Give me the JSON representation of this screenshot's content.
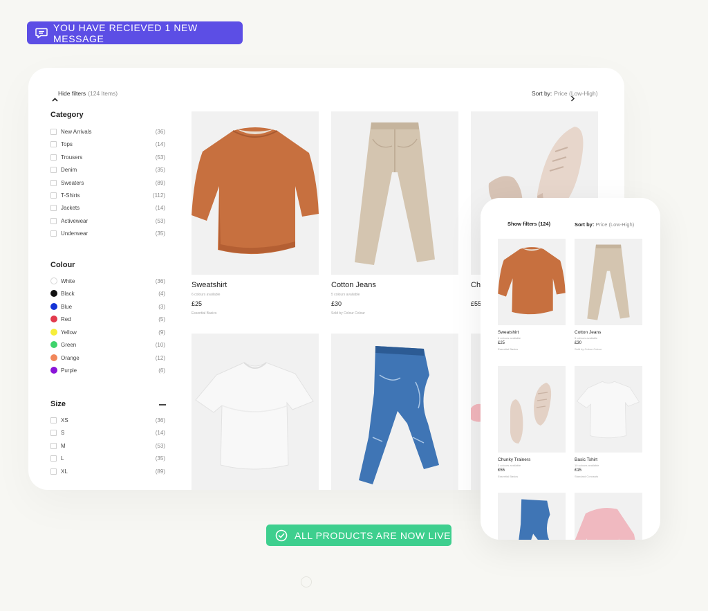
{
  "notification": {
    "text": "YOU HAVE RECIEVED 1 NEW MESSAGE",
    "color": "#5c4ee5"
  },
  "status_banner": {
    "text": "ALL PRODUCTS ARE NOW LIVE",
    "color": "#3ecf8e"
  },
  "desktop": {
    "toolbar": {
      "hide_filters": "Hide filters",
      "item_count": "(124 Items)",
      "sort_label": "Sort by:",
      "sort_value": "Price (Low-High)"
    },
    "filters": {
      "category": {
        "title": "Category",
        "items": [
          {
            "label": "New Arrivals",
            "count": "(36)"
          },
          {
            "label": "Tops",
            "count": "(14)"
          },
          {
            "label": "Trousers",
            "count": "(53)"
          },
          {
            "label": "Denim",
            "count": "(35)"
          },
          {
            "label": "Sweaters",
            "count": "(89)"
          },
          {
            "label": "T-Shirts",
            "count": "(112)"
          },
          {
            "label": "Jackets",
            "count": "(14)"
          },
          {
            "label": "Activewear",
            "count": "(53)"
          },
          {
            "label": "Underwear",
            "count": "(35)"
          }
        ]
      },
      "colour": {
        "title": "Colour",
        "items": [
          {
            "label": "White",
            "count": "(36)",
            "color": "#ffffff"
          },
          {
            "label": "Black",
            "count": "(4)",
            "color": "#111111"
          },
          {
            "label": "Blue",
            "count": "(3)",
            "color": "#1433d6"
          },
          {
            "label": "Red",
            "count": "(5)",
            "color": "#e23a4d"
          },
          {
            "label": "Yellow",
            "count": "(9)",
            "color": "#f6ee3a"
          },
          {
            "label": "Green",
            "count": "(10)",
            "color": "#3ed36b"
          },
          {
            "label": "Orange",
            "count": "(12)",
            "color": "#f1875a"
          },
          {
            "label": "Purple",
            "count": "(6)",
            "color": "#8a14d8"
          }
        ]
      },
      "size": {
        "title": "Size",
        "items": [
          {
            "label": "XS",
            "count": "(36)"
          },
          {
            "label": "S",
            "count": "(14)"
          },
          {
            "label": "M",
            "count": "(53)"
          },
          {
            "label": "L",
            "count": "(35)"
          },
          {
            "label": "XL",
            "count": "(89)"
          }
        ]
      }
    },
    "products": [
      {
        "name": "Sweatshirt",
        "sub": "6 colours available",
        "price": "£25",
        "vendor": "Essential Basics"
      },
      {
        "name": "Cotton Jeans",
        "sub": "5 colours available",
        "price": "£30",
        "vendor": "Sold by Colour Colour"
      },
      {
        "name": "Ch",
        "sub": "",
        "price": "£55",
        "vendor": ""
      }
    ]
  },
  "mobile": {
    "show_filters": "Show filters (124)",
    "sort_label": "Sort by:",
    "sort_value": "Price (Low-High)",
    "products": [
      {
        "name": "Sweatshirt",
        "sub": "6 colours available",
        "price": "£25",
        "vendor": "Essential Basics"
      },
      {
        "name": "Cotton Jeans",
        "sub": "5 colours available",
        "price": "£30",
        "vendor": "Sold by Colour Colour"
      },
      {
        "name": "Chunky Trainers",
        "sub": "3 colours available",
        "price": "£55",
        "vendor": "Essential Basics"
      },
      {
        "name": "Basic Tshirt",
        "sub": "10 colours available",
        "price": "£15",
        "vendor": "Standard Concepts"
      }
    ]
  },
  "icons": {
    "message": "chat-bubble-icon",
    "check": "check-circle-icon",
    "collapse": "chevron-up-icon",
    "sort": "chevron-right-icon",
    "size-collapse": "minus-icon"
  }
}
